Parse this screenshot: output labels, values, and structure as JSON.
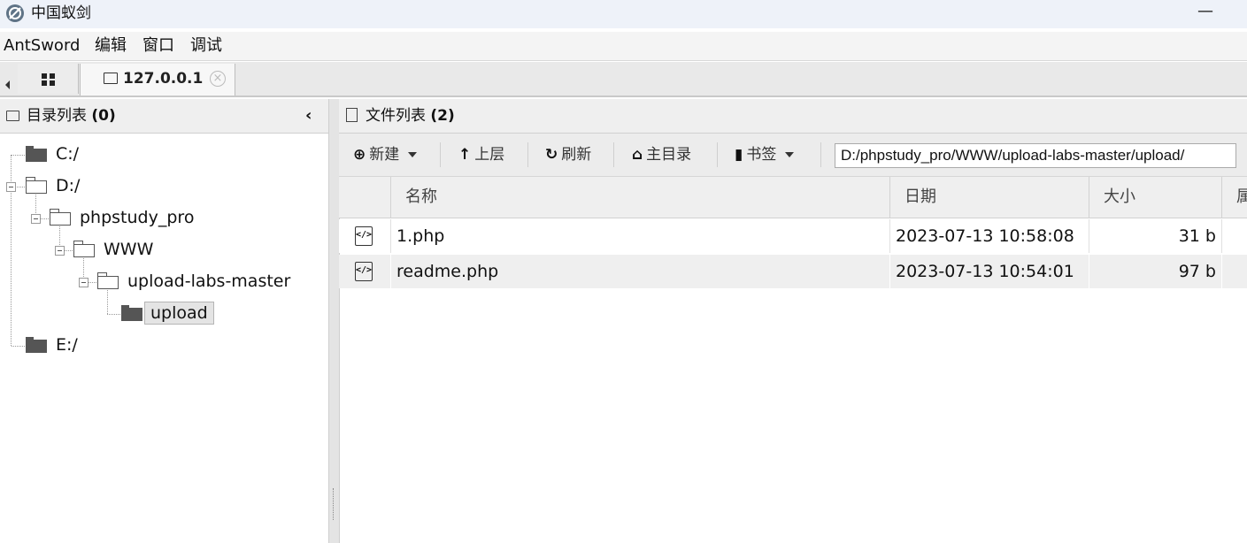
{
  "window": {
    "title": "中国蚁剑",
    "minimize_glyph": "—"
  },
  "menubar": {
    "items": [
      "AntSword",
      "编辑",
      "窗口",
      "调试"
    ]
  },
  "tabs": {
    "host_label": "127.0.0.1",
    "close_glyph": "×"
  },
  "left_panel": {
    "title": "目录列表",
    "count": "(0)",
    "collapse_glyph": "‹",
    "tree": [
      {
        "label": "C:/"
      },
      {
        "label": "D:/"
      },
      {
        "label": "phpstudy_pro"
      },
      {
        "label": "WWW"
      },
      {
        "label": "upload-labs-master"
      },
      {
        "label": "upload",
        "selected": true
      },
      {
        "label": "E:/"
      }
    ]
  },
  "right_panel": {
    "title": "文件列表",
    "count": "(2)",
    "toolbar": {
      "new_label": "新建",
      "up_label": "上层",
      "refresh_label": "刷新",
      "home_label": "主目录",
      "bookmark_label": "书签",
      "path_value": "D:/phpstudy_pro/WWW/upload-labs-master/upload/"
    },
    "columns": {
      "name": "名称",
      "date": "日期",
      "size": "大小",
      "attr": "属"
    },
    "files": [
      {
        "name": "1.php",
        "date": "2023-07-13 10:58:08",
        "size": "31 b",
        "icon": "code-file-icon"
      },
      {
        "name": "readme.php",
        "date": "2023-07-13 10:54:01",
        "size": "97 b",
        "icon": "code-file-icon"
      }
    ]
  }
}
